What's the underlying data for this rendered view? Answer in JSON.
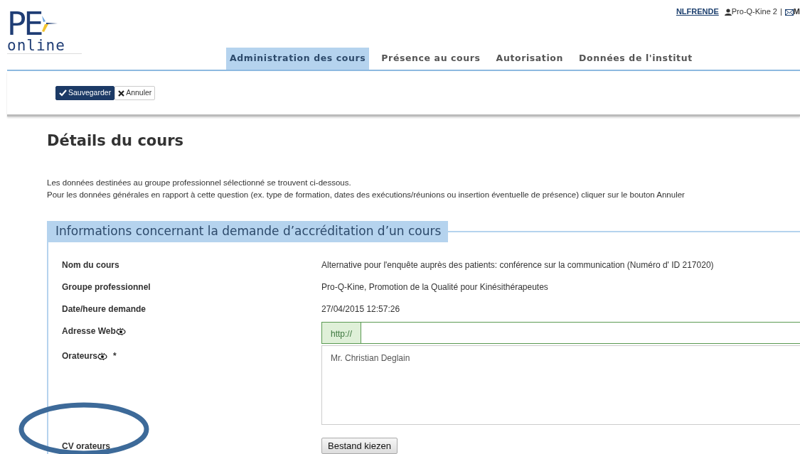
{
  "header": {
    "account_link": "NLFRENDE",
    "user": "Pro-Q-Kine 2",
    "separator": "|",
    "mail_link": "M"
  },
  "logo": {
    "letters": "PE",
    "word": "online"
  },
  "tabs": [
    {
      "label": "Administration des cours",
      "selected": true
    },
    {
      "label": "Présence au cours",
      "selected": false
    },
    {
      "label": "Autorisation",
      "selected": false
    },
    {
      "label": "Données de l'institut",
      "selected": false
    }
  ],
  "toolbar": [
    {
      "label": "Sauvegarder",
      "kind": "save"
    },
    {
      "label": "Annuler",
      "kind": "cancel"
    }
  ],
  "title": "Détails du cours",
  "intro": [
    "Les données destinées au groupe professionnel sélectionné se trouvent ci-dessous.",
    "Pour les données générales en rapport à cette question (ex. type de formation, dates des exécutions/réunions ou insertion éventuelle de présence) cliquer sur le bouton Annuler"
  ],
  "section": {
    "legend": "Informations concernant la demande d’accréditation d’un cours",
    "fields": [
      {
        "label": "Nom du cours",
        "kind": "text",
        "value": "Alternative pour l'enquête auprès des patients: conférence sur la communication (Numéro d' ID 217020)"
      },
      {
        "label": "Groupe professionnel",
        "kind": "text",
        "value": "Pro-Q-Kine, Promotion de la Qualité pour Kinésithérapeutes"
      },
      {
        "label": "Date/heure demande",
        "kind": "text",
        "value": "27/04/2015 12:57:26"
      },
      {
        "label": "Adresse Web",
        "kind": "url",
        "help_icon": true,
        "prefix": "http://"
      },
      {
        "label": "Orateurs",
        "kind": "textarea",
        "help_icon": true,
        "required": "*",
        "value": "Mr. Christian Deglain"
      },
      {
        "label": "CV orateurs",
        "kind": "file",
        "button": "Bestand kiezen"
      }
    ]
  }
}
